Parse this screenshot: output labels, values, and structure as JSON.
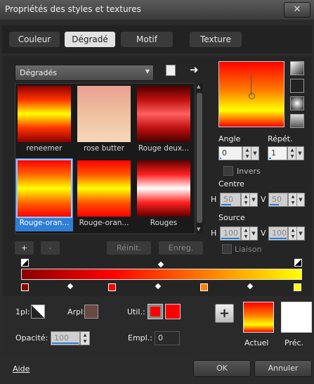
{
  "window": {
    "title": "Propriétés des styles et textures",
    "close": "✕"
  },
  "tabs": [
    "Couleur",
    "Dégradé",
    "Motif",
    "Texture"
  ],
  "gradient_dropdown": {
    "value": "Dégradés"
  },
  "gradients": [
    {
      "name": "reneemer",
      "colors": "#8b0000,#ff3300,#ffff00,#ff3300,#8b0000"
    },
    {
      "name": "rose butter",
      "colors": "#e8a090,#f0c0a0,#f4d8b8"
    },
    {
      "name": "Rouge deux...",
      "colors": "#4a0000,#c01010,#ff6060,#c01010,#4a0000"
    },
    {
      "name": "Rouge-oran...",
      "colors": "#ff0000,#ff6600,#ffff00,#ff6600,#ff0000"
    },
    {
      "name": "Rouge-oran...",
      "colors": "#ff0000,#ff5500,#ffff00,#ff5500,#ff0000"
    },
    {
      "name": "Rouges",
      "colors": "#600000,#ff2020,#ffffff,#ff2020,#600000"
    }
  ],
  "list_buttons": {
    "add": "+",
    "remove": "-",
    "reset": "Réinit.",
    "save": "Enreg."
  },
  "angle": {
    "label": "Angle",
    "value": "0"
  },
  "repeat": {
    "label": "Répét.",
    "value": "1"
  },
  "invert": {
    "label": "Invers"
  },
  "centre": {
    "label": "Centre",
    "h_label": "H",
    "h_value": "50",
    "v_label": "V",
    "v_value": "50"
  },
  "source": {
    "label": "Source",
    "h_label": "H",
    "h_value": "100",
    "v_label": "V",
    "v_value": "100"
  },
  "link": {
    "label": "Liaison"
  },
  "stops": {
    "markers": [
      "#8b0000",
      "#ff0000",
      "#ff8000",
      "#ffff00"
    ]
  },
  "bottom": {
    "opl_label": "1pl:",
    "arpl_label": "Arpl:",
    "util_label": "Util.:",
    "opacity_label": "Opacité:",
    "opacity_value": "100",
    "empl_label": "Empl.:",
    "empl_value": "0",
    "add": "+",
    "current_label": "Actuel",
    "prev_label": "Préc."
  },
  "footer": {
    "help": "Aide",
    "ok": "OK",
    "cancel": "Annuler"
  }
}
